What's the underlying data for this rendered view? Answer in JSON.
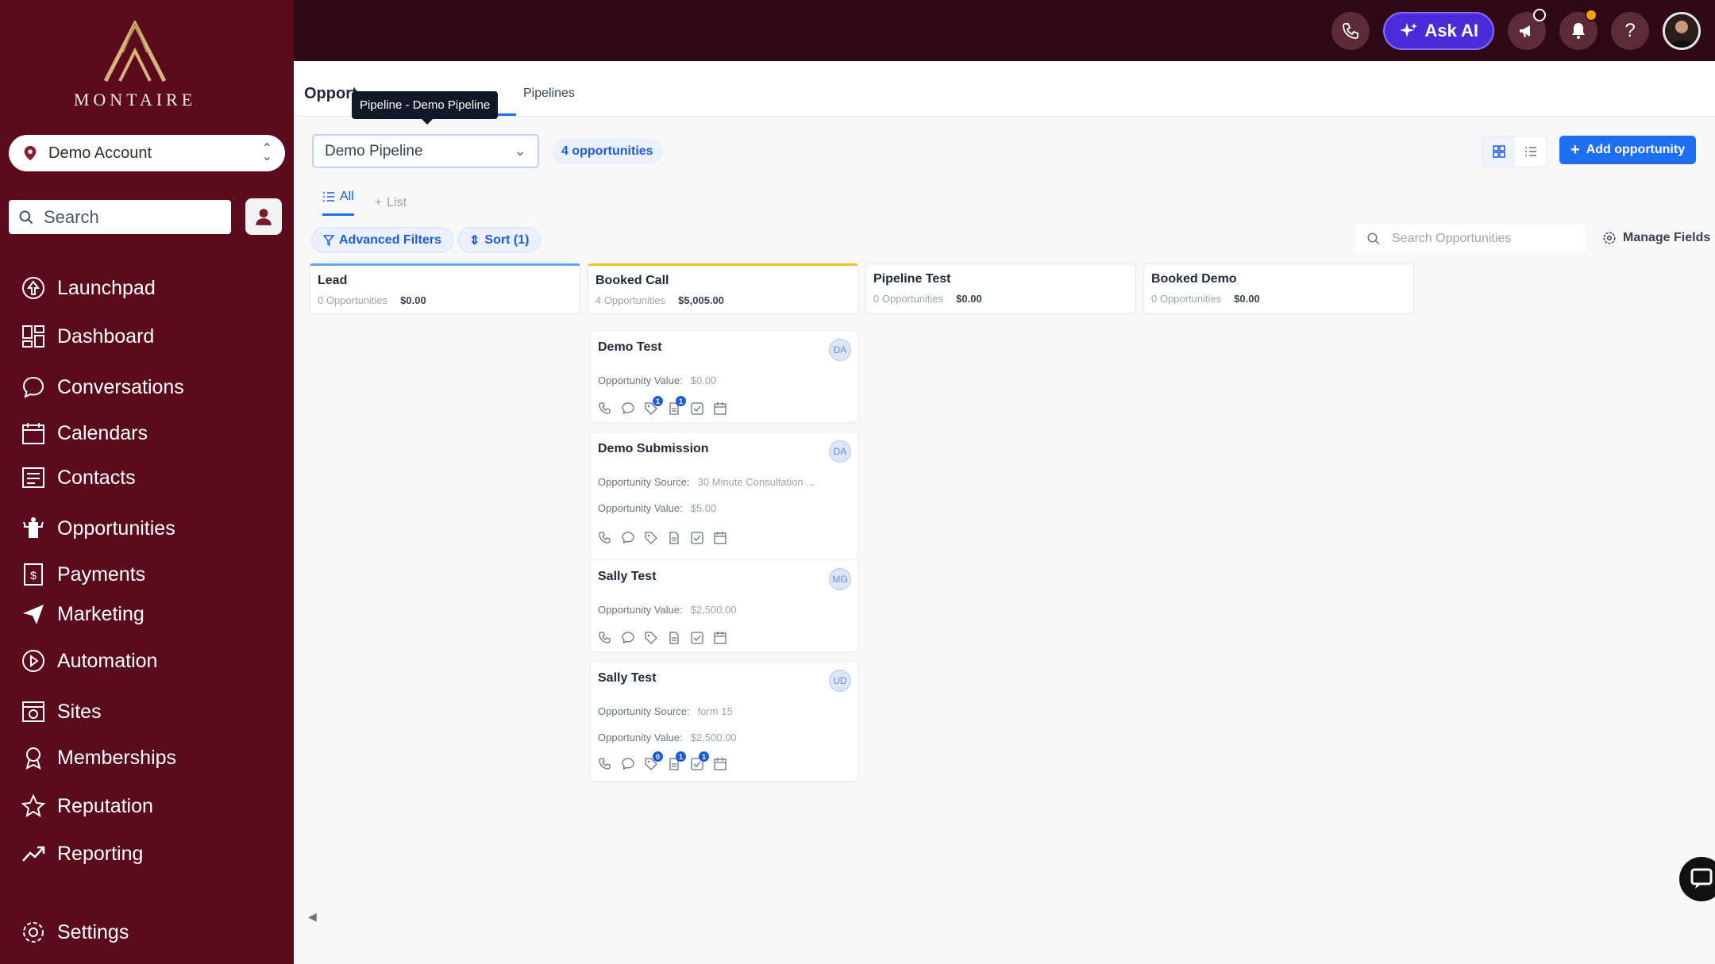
{
  "sidebar": {
    "logo_text": "MONTAIRE",
    "account": "Demo Account",
    "search_placeholder": "Search",
    "items": [
      {
        "label": "Launchpad"
      },
      {
        "label": "Dashboard"
      },
      {
        "label": "Conversations"
      },
      {
        "label": "Calendars"
      },
      {
        "label": "Contacts"
      },
      {
        "label": "Opportunities"
      },
      {
        "label": "Payments"
      },
      {
        "label": "Marketing"
      },
      {
        "label": "Automation"
      },
      {
        "label": "Sites"
      },
      {
        "label": "Memberships"
      },
      {
        "label": "Reputation"
      },
      {
        "label": "Reporting"
      },
      {
        "label": "Settings"
      }
    ]
  },
  "topbar": {
    "ask_ai": "Ask AI"
  },
  "header": {
    "title": "Opport",
    "tab_pipelines": "Pipelines",
    "tooltip": "Pipeline - Demo Pipeline"
  },
  "toolbar": {
    "pipeline": "Demo Pipeline",
    "count": "4 opportunities",
    "add": "Add opportunity",
    "tab_all": "All",
    "tab_list": "List",
    "advanced_filters": "Advanced Filters",
    "sort": "Sort (1)",
    "search_placeholder": "Search Opportunities",
    "manage_fields": "Manage Fields"
  },
  "stages": [
    {
      "name": "Lead",
      "count": "0 Opportunities",
      "value": "$0.00",
      "color": "#60a5fa"
    },
    {
      "name": "Booked Call",
      "count": "4 Opportunities",
      "value": "$5,005.00",
      "color": "#fbbf24"
    },
    {
      "name": "Pipeline Test",
      "count": "0 Opportunities",
      "value": "$0.00",
      "color": "#e5e7eb"
    },
    {
      "name": "Booked Demo",
      "count": "0 Opportunities",
      "value": "$0.00",
      "color": "#e5e7eb"
    }
  ],
  "cards": [
    {
      "title": "Demo Test",
      "initials": "DA",
      "source": "",
      "value_label": "Opportunity Value:",
      "value": "$0.00",
      "source_label": "",
      "badges": [
        "",
        "",
        "1",
        "1",
        "",
        ""
      ]
    },
    {
      "title": "Demo Submission",
      "initials": "DA",
      "source_label": "Opportunity Source:",
      "source": "30 Minute Consultation ...",
      "value_label": "Opportunity Value:",
      "value": "$5.00",
      "badges": [
        "",
        "",
        "",
        "",
        "",
        ""
      ]
    },
    {
      "title": "Sally Test",
      "initials": "MG",
      "source_label": "",
      "source": "",
      "value_label": "Opportunity Value:",
      "value": "$2,500.00",
      "badges": [
        "",
        "",
        "",
        "",
        "",
        ""
      ]
    },
    {
      "title": "Sally Test",
      "initials": "UD",
      "source_label": "Opportunity Source:",
      "source": "form 15",
      "value_label": "Opportunity Value:",
      "value": "$2,500.00",
      "badges": [
        "",
        "",
        "0",
        "1",
        "1",
        ""
      ]
    }
  ]
}
